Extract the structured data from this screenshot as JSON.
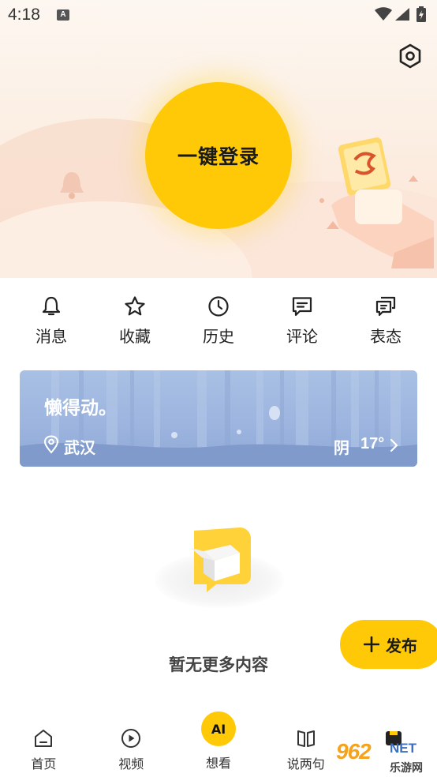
{
  "status_bar": {
    "time": "4:18",
    "notification_badge": "A"
  },
  "header": {
    "login_label": "一键登录"
  },
  "quick_actions": [
    {
      "label": "消息",
      "icon": "bell-icon"
    },
    {
      "label": "收藏",
      "icon": "star-icon"
    },
    {
      "label": "历史",
      "icon": "clock-icon"
    },
    {
      "label": "评论",
      "icon": "comment-icon"
    },
    {
      "label": "表态",
      "icon": "reactions-icon"
    }
  ],
  "weather": {
    "slogan": "懒得动。",
    "city": "武汉",
    "condition": "阴",
    "temperature": "17°"
  },
  "empty_state": {
    "text": "暂无更多内容"
  },
  "fab": {
    "label": "发布"
  },
  "bottom_nav": [
    {
      "label": "首页",
      "icon": "home-icon"
    },
    {
      "label": "视频",
      "icon": "play-icon"
    },
    {
      "label": "想看",
      "icon": "ai-icon",
      "badge": "AI"
    },
    {
      "label": "说两句",
      "icon": "book-icon"
    },
    {
      "label": "",
      "icon": "profile-icon"
    }
  ],
  "watermark": {
    "brand": "962",
    "net": "NET",
    "site": "乐游网"
  },
  "colors": {
    "accent": "#ffc907",
    "weather_bg": "#a9c0e4",
    "header_bg": "#fcefe4"
  }
}
